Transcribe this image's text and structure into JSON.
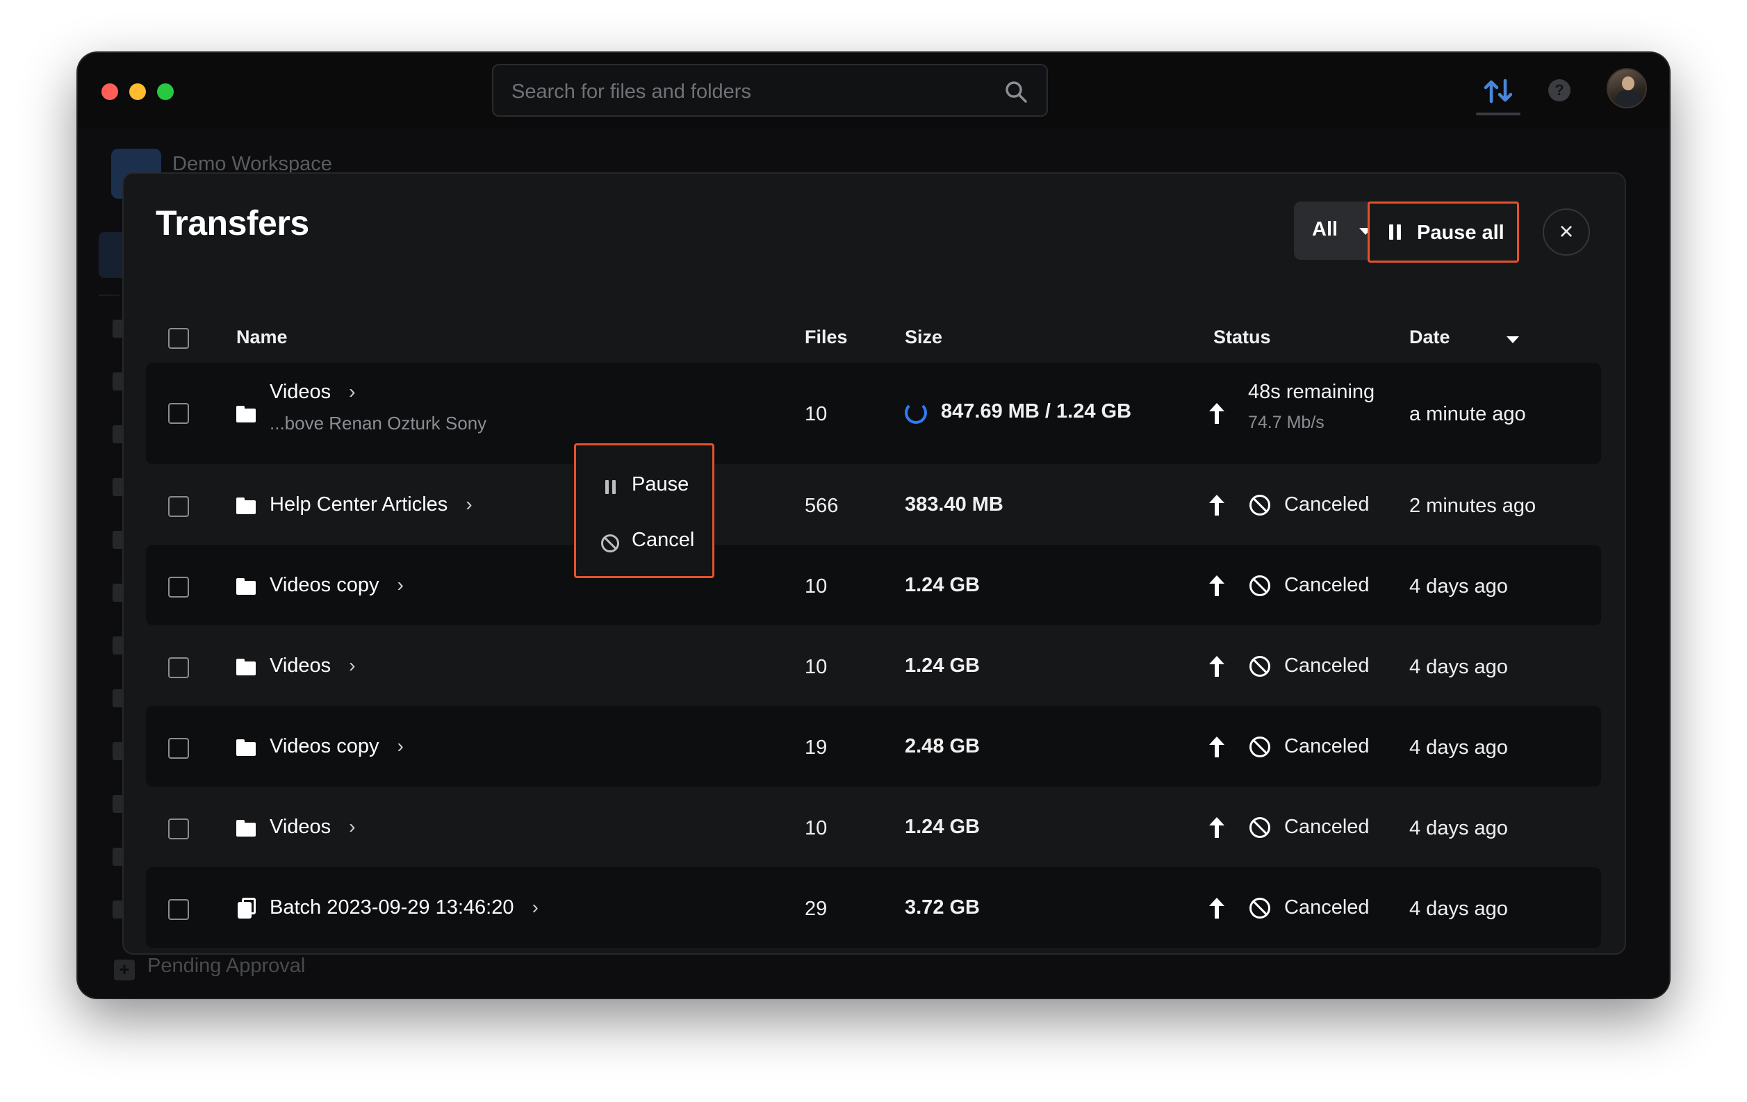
{
  "app": {
    "search": {
      "placeholder": "Search for files and folders"
    },
    "workspace_name": "Demo Workspace",
    "pending_label": "Pending Approval"
  },
  "colors": {
    "accent_highlight": "#e4522c",
    "progress": "#2f7cf6",
    "background": "#141517"
  },
  "modal": {
    "title": "Transfers",
    "filter_label": "All",
    "pause_all_label": "Pause all",
    "close_icon": "×",
    "columns": {
      "name": "Name",
      "files": "Files",
      "size": "Size",
      "status": "Status",
      "date": "Date"
    },
    "rows": [
      {
        "icon": "folder-icon",
        "name": "Videos",
        "sub": "...bove Renan Ozturk Sony",
        "files": "10",
        "size": "847.69 MB / 1.24 GB",
        "status": "48s remaining",
        "status_sub": "74.7 Mb/s",
        "date": "a minute ago",
        "in_progress": true
      },
      {
        "icon": "folder-icon",
        "name": "Help Center Articles",
        "files": "566",
        "size": "383.40 MB",
        "status": "Canceled",
        "date": "2 minutes ago"
      },
      {
        "icon": "folder-icon",
        "name": "Videos copy",
        "files": "10",
        "size": "1.24 GB",
        "status": "Canceled",
        "date": "4 days ago"
      },
      {
        "icon": "folder-icon",
        "name": "Videos",
        "files": "10",
        "size": "1.24 GB",
        "status": "Canceled",
        "date": "4 days ago"
      },
      {
        "icon": "folder-icon",
        "name": "Videos copy",
        "files": "19",
        "size": "2.48 GB",
        "status": "Canceled",
        "date": "4 days ago"
      },
      {
        "icon": "folder-icon",
        "name": "Videos",
        "files": "10",
        "size": "1.24 GB",
        "status": "Canceled",
        "date": "4 days ago"
      },
      {
        "icon": "batch-icon",
        "name": "Batch 2023-09-29 13:46:20",
        "files": "29",
        "size": "3.72 GB",
        "status": "Canceled",
        "date": "4 days ago"
      }
    ],
    "context_menu": {
      "pause_label": "Pause",
      "cancel_label": "Cancel"
    }
  }
}
